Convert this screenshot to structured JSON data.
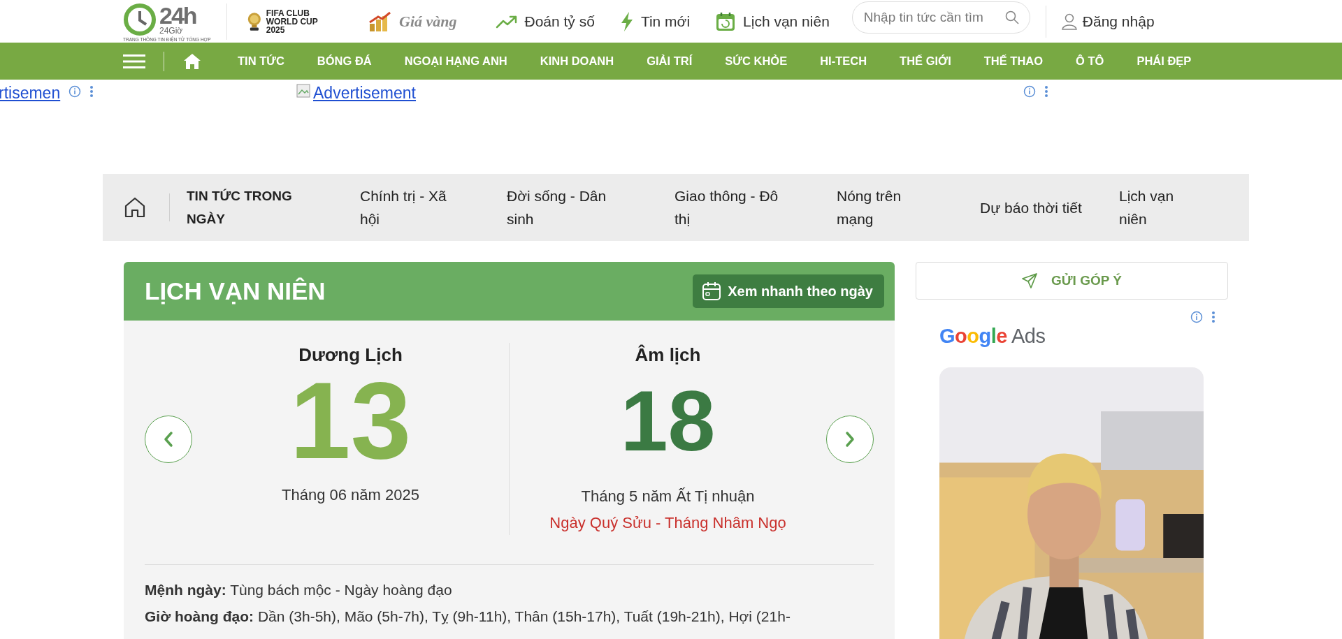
{
  "header": {
    "logo": {
      "mark": "24h",
      "name": "24Giờ",
      "tagline": "TRANG THÔNG TIN ĐIỆN TỬ TỔNG HỢP"
    },
    "links": [
      {
        "kind": "trophy",
        "label": "FIFA CLUB WORLD CUP 2025"
      },
      {
        "kind": "gold",
        "label": "Giá vàng"
      },
      {
        "kind": "trend",
        "label": "Đoán tỷ số"
      },
      {
        "kind": "bolt",
        "label": "Tin mới"
      },
      {
        "kind": "calendar",
        "label": "Lịch vạn niên"
      }
    ],
    "search": {
      "placeholder": "Nhập tin tức cần tìm"
    },
    "login": "Đăng nhập"
  },
  "main_nav": {
    "items": [
      "TIN TỨC",
      "BÓNG ĐÁ",
      "NGOẠI HẠNG ANH",
      "KINH DOANH",
      "GIẢI TRÍ",
      "SỨC KHỎE",
      "HI-TECH",
      "THẾ GIỚI",
      "THẾ THAO",
      "Ô TÔ",
      "PHÁI ĐẸP"
    ]
  },
  "ads": {
    "left_link": "rtisemen",
    "banner_link": "Advertisement"
  },
  "section_nav": {
    "title": "TIN TỨC TRONG NGÀY",
    "items": [
      "Chính trị - Xã hội",
      "Đời sống - Dân sinh",
      "Giao thông - Đô thị",
      "Nóng trên mạng",
      "Dự báo thời tiết",
      "Lịch vạn niên"
    ]
  },
  "calendar": {
    "title": "LỊCH VẠN NIÊN",
    "quick_button": "Xem nhanh theo ngày",
    "solar": {
      "heading": "Dương Lịch",
      "day": "13",
      "month_year": "Tháng 06 năm 2025"
    },
    "lunar": {
      "heading": "Âm lịch",
      "day": "18",
      "month_year": "Tháng 5 năm Ất Tị nhuận",
      "can_chi": "Ngày Quý Sửu - Tháng Nhâm Ngọ"
    },
    "details": [
      "**Mệnh ngày:** Tùng bách mộc - Ngày hoàng đạo",
      "**Giờ hoàng đạo:** Dần (3h-5h), Mão (5h-7h), Tỵ (9h-11h), Thân (15h-17h), Tuất (19h-21h), Hợi (21h-"
    ]
  },
  "sidebar": {
    "feedback_button": "GỬI GÓP Ý",
    "ad": {
      "brand": "Google Ads"
    }
  }
}
